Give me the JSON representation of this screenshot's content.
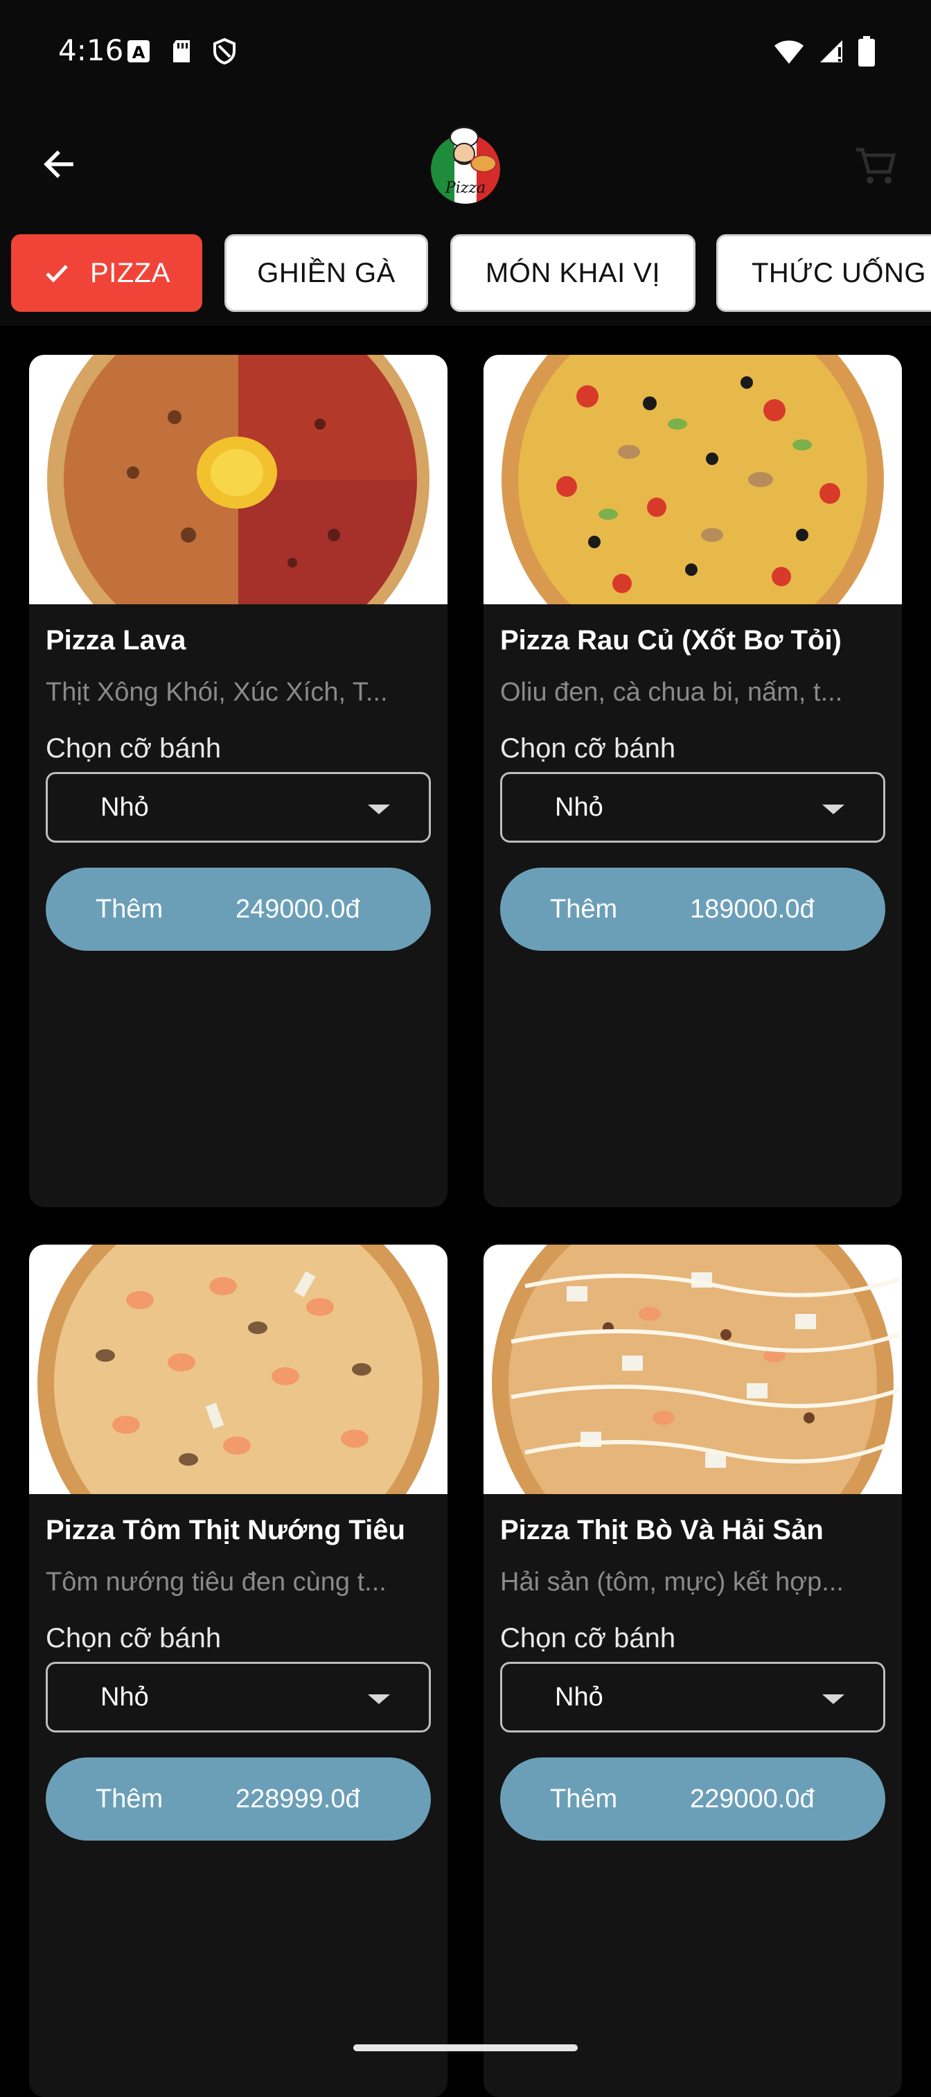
{
  "status_bar": {
    "time": "4:16"
  },
  "app_bar": {
    "logo_text": "Pizza"
  },
  "categories": [
    {
      "label": "PIZZA",
      "active": true
    },
    {
      "label": "GHIỀN GÀ",
      "active": false
    },
    {
      "label": "MÓN KHAI VỊ",
      "active": false
    },
    {
      "label": "THỨC UỐNG",
      "active": false
    }
  ],
  "products": [
    {
      "name": "Pizza Lava",
      "description": "Thịt Xông Khói, Xúc Xích, T...",
      "size_label": "Chọn cỡ bánh",
      "size_value": "Nhỏ",
      "add_label": "Thêm",
      "price": "249000.0đ"
    },
    {
      "name": "Pizza Rau Củ (Xốt Bơ Tỏi)",
      "description": "Oliu đen, cà chua bi, nấm, t...",
      "size_label": "Chọn cỡ bánh",
      "size_value": "Nhỏ",
      "add_label": "Thêm",
      "price": "189000.0đ"
    },
    {
      "name": "Pizza Tôm Thịt Nướng Tiêu",
      "description": "Tôm nướng tiêu đen cùng t...",
      "size_label": "Chọn cỡ bánh",
      "size_value": "Nhỏ",
      "add_label": "Thêm",
      "price": "228999.0đ"
    },
    {
      "name": "Pizza Thịt Bò Và Hải Sản",
      "description": "Hải sản (tôm, mực) kết hợp...",
      "size_label": "Chọn cỡ bánh",
      "size_value": "Nhỏ",
      "add_label": "Thêm",
      "price": "229000.0đ"
    }
  ],
  "colors": {
    "accent_chip": "#f04438",
    "add_button": "#6b9fb8",
    "card_bg": "#141414"
  }
}
